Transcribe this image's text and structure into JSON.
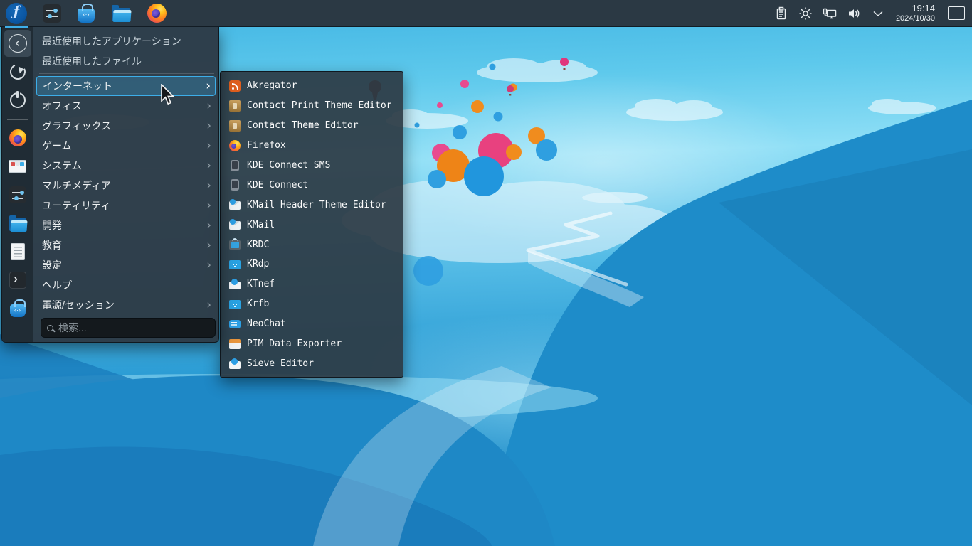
{
  "colors": {
    "accent": "#3daee9",
    "panel_bg": "#2b3944",
    "menu_bg": "#2d3b46",
    "selection_fill": "rgba(61,174,233,0.28)"
  },
  "panel": {
    "clock": {
      "time": "19:14",
      "date": "2024/10/30"
    }
  },
  "menu": {
    "recent": [
      {
        "label": "最近使用したアプリケーション"
      },
      {
        "label": "最近使用したファイル"
      }
    ],
    "categories": [
      {
        "label": "インターネット",
        "has_submenu": true,
        "selected": true
      },
      {
        "label": "オフィス",
        "has_submenu": true
      },
      {
        "label": "グラフィックス",
        "has_submenu": true
      },
      {
        "label": "ゲーム",
        "has_submenu": true
      },
      {
        "label": "システム",
        "has_submenu": true
      },
      {
        "label": "マルチメディア",
        "has_submenu": true
      },
      {
        "label": "ユーティリティ",
        "has_submenu": true
      },
      {
        "label": "開発",
        "has_submenu": true
      },
      {
        "label": "教育",
        "has_submenu": true
      },
      {
        "label": "設定",
        "has_submenu": true
      },
      {
        "label": "ヘルプ",
        "has_submenu": false
      },
      {
        "label": "電源/セッション",
        "has_submenu": true
      }
    ],
    "search": {
      "placeholder": "検索..."
    }
  },
  "submenu": {
    "items": [
      {
        "label": "Akregator",
        "icon": "akregator-icon"
      },
      {
        "label": "Contact Print Theme Editor",
        "icon": "contact-theme-icon"
      },
      {
        "label": "Contact Theme Editor",
        "icon": "contact-theme-icon"
      },
      {
        "label": "Firefox",
        "icon": "firefox-icon"
      },
      {
        "label": "KDE Connect SMS",
        "icon": "kdeconnect-icon"
      },
      {
        "label": "KDE Connect",
        "icon": "kdeconnect-icon"
      },
      {
        "label": "KMail Header Theme Editor",
        "icon": "kmail-icon"
      },
      {
        "label": "KMail",
        "icon": "kmail-icon"
      },
      {
        "label": "KRDC",
        "icon": "krdc-icon"
      },
      {
        "label": "KRdp",
        "icon": "remote-desktop-icon"
      },
      {
        "label": "KTnef",
        "icon": "mail-attachment-icon"
      },
      {
        "label": "Krfb",
        "icon": "screen-share-icon"
      },
      {
        "label": "NeoChat",
        "icon": "chat-icon"
      },
      {
        "label": "PIM Data Exporter",
        "icon": "pim-export-icon"
      },
      {
        "label": "Sieve Editor",
        "icon": "mail-filter-icon"
      }
    ]
  }
}
